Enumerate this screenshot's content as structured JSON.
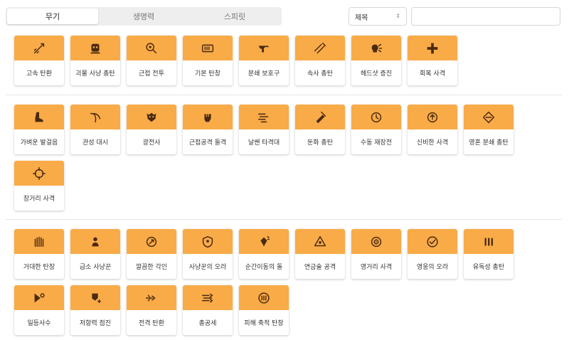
{
  "tabs": [
    "무기",
    "생명력",
    "스피릿"
  ],
  "sort": {
    "value": "제목"
  },
  "search": {
    "value": ""
  },
  "colors": {
    "card_top": "#f9ab48",
    "icon": "#4a2a10"
  },
  "sections": [
    {
      "items": [
        {
          "label": "고속 탄환",
          "icon": "bullet-trail-icon"
        },
        {
          "label": "괴물 사냥 총탄",
          "icon": "monster-icon"
        },
        {
          "label": "근접 전투",
          "icon": "magnifier-target-icon"
        },
        {
          "label": "기본 탄창",
          "icon": "magazine-icon"
        },
        {
          "label": "분쇄 보호구",
          "icon": "gun-icon"
        },
        {
          "label": "속사 총탄",
          "icon": "rapid-fire-icon"
        },
        {
          "label": "헤드샷 증진",
          "icon": "head-burst-icon"
        },
        {
          "label": "회복 사격",
          "icon": "plus-icon"
        }
      ]
    },
    {
      "items": [
        {
          "label": "가벼운 발걸음",
          "icon": "boot-icon"
        },
        {
          "label": "관성 대시",
          "icon": "dash-swirl-icon"
        },
        {
          "label": "광전사",
          "icon": "berserker-mask-icon"
        },
        {
          "label": "근접공격 돌격",
          "icon": "fist-icon"
        },
        {
          "label": "날쌘 타격대",
          "icon": "speed-lines-icon"
        },
        {
          "label": "둔화 총탄",
          "icon": "slow-bullet-icon"
        },
        {
          "label": "수동 재장전",
          "icon": "reload-clock-icon"
        },
        {
          "label": "신비한 사격",
          "icon": "mystic-shot-icon"
        },
        {
          "label": "영혼 분쇄 총탄",
          "icon": "soul-shredder-icon"
        },
        {
          "label": "장거리 사격",
          "icon": "crosshair-icon"
        }
      ]
    },
    {
      "items": [
        {
          "label": "거대한 탄창",
          "icon": "big-magazine-icon"
        },
        {
          "label": "급소 사냥꾼",
          "icon": "hunter-icon"
        },
        {
          "label": "깔끔한 각인",
          "icon": "engraving-icon"
        },
        {
          "label": "사냥꾼의 오라",
          "icon": "hunter-aura-icon"
        },
        {
          "label": "순간이동의 돌",
          "icon": "teleport-stone-icon"
        },
        {
          "label": "연금술 공격",
          "icon": "alchemy-icon"
        },
        {
          "label": "영거리 사격",
          "icon": "point-blank-icon"
        },
        {
          "label": "영웅의 오라",
          "icon": "hero-aura-icon"
        },
        {
          "label": "유독성 총탄",
          "icon": "toxic-bullets-icon"
        },
        {
          "label": "일등사수",
          "icon": "marksman-icon"
        },
        {
          "label": "저항력 점진",
          "icon": "resist-ramp-icon"
        },
        {
          "label": "전격 탄환",
          "icon": "shock-bullet-icon"
        },
        {
          "label": "총공세",
          "icon": "barrage-icon"
        },
        {
          "label": "피해 축적 탄창",
          "icon": "damage-stack-icon"
        }
      ]
    }
  ]
}
